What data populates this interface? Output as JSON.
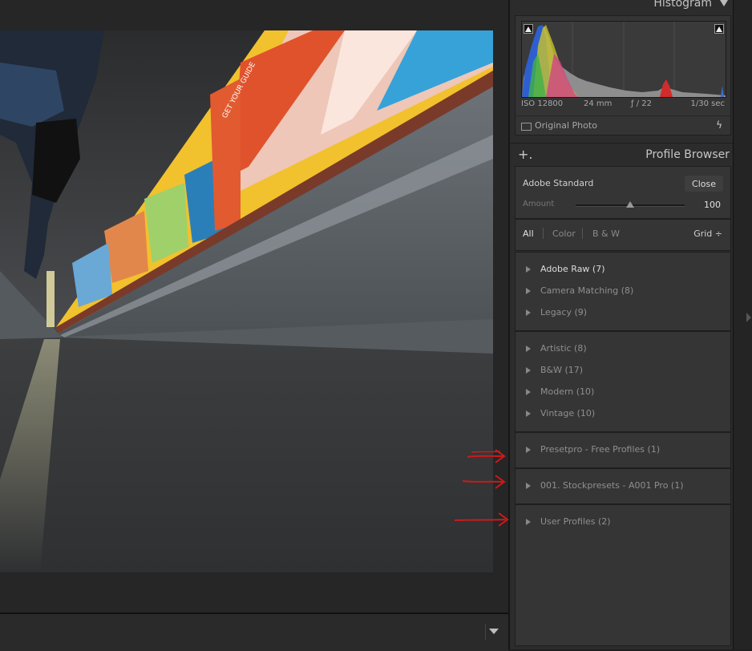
{
  "histogram": {
    "title": "Histogram",
    "exif": {
      "iso": "ISO 12800",
      "focal": "24 mm",
      "aperture": "ƒ / 22",
      "shutter": "1/30 sec"
    },
    "original_photo_label": "Original Photo"
  },
  "profile_browser": {
    "title": "Profile Browser",
    "current_profile": "Adobe Standard",
    "close_label": "Close",
    "amount_label": "Amount",
    "amount_value": "100",
    "amount_fraction": 0.5,
    "filters": [
      "All",
      "Color",
      "B & W"
    ],
    "view_select": "Grid ÷",
    "groups": [
      {
        "items": [
          "Adobe Raw (7)",
          "Camera Matching (8)",
          "Legacy (9)"
        ]
      },
      {
        "items": [
          "Artistic (8)",
          "B&W (17)",
          "Modern (10)",
          "Vintage (10)"
        ]
      },
      {
        "items": [
          "Presetpro - Free Profiles (1)"
        ]
      },
      {
        "items": [
          "001. Stockpresets - A001 Pro (1)"
        ]
      },
      {
        "items": [
          "User Profiles (2)"
        ]
      }
    ]
  },
  "photo_poster_text": [
    "GET YOUR GUIDE"
  ],
  "colors": {
    "annotation_arrow": "#cc1a1a",
    "panel_bg": "#2c2c2c"
  }
}
